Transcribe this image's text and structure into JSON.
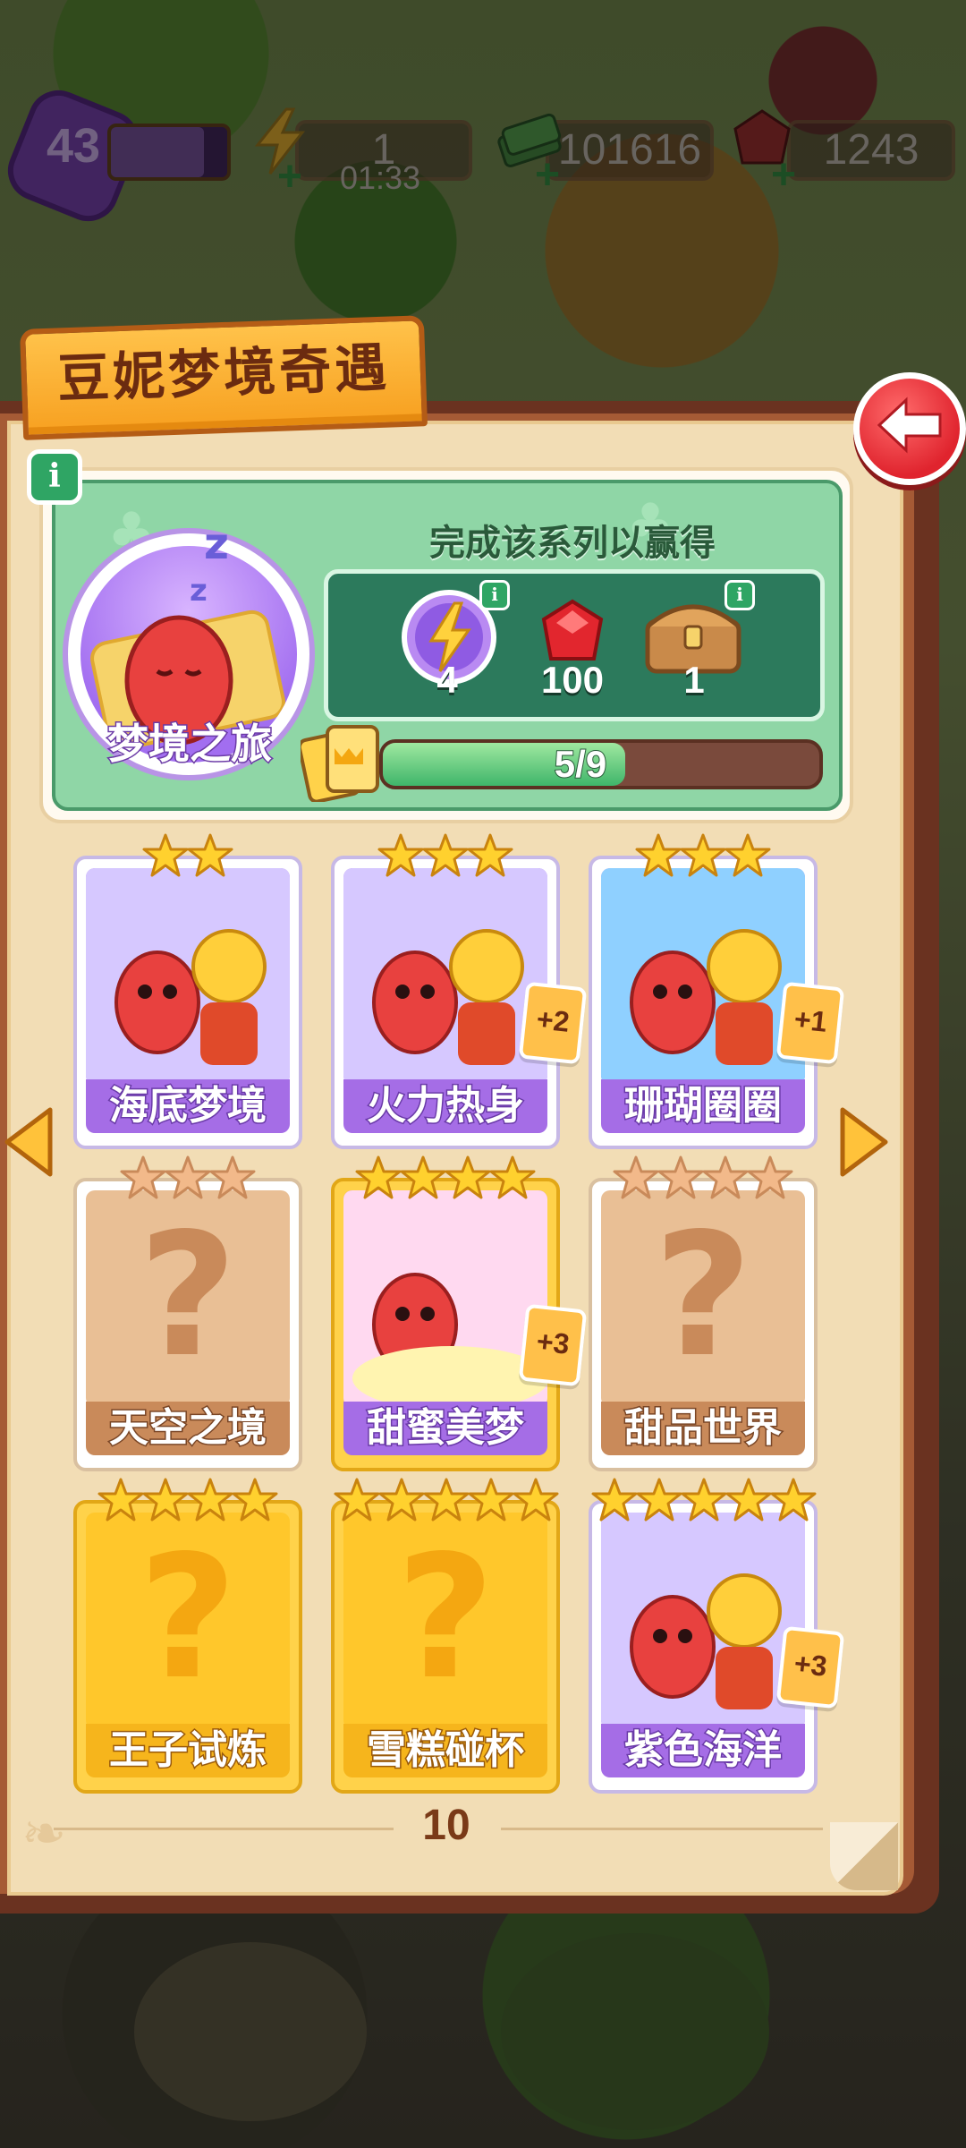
{
  "hud": {
    "level": "43",
    "energy": "1",
    "energy_timer": "01:33",
    "cash": "101616",
    "gems": "1243"
  },
  "book": {
    "title": "豆妮梦境奇遇",
    "info_label": "i",
    "page_number": "10"
  },
  "series": {
    "name": "梦境之旅",
    "reward_heading": "完成该系列以赢得",
    "rewards": [
      {
        "icon": "energy-orb-icon",
        "count": "4"
      },
      {
        "icon": "ruby-icon",
        "count": "100"
      },
      {
        "icon": "treasure-chest-icon",
        "count": "1"
      }
    ],
    "progress_text": "5/9",
    "progress": 0.5556
  },
  "cards": [
    {
      "name": "海底梦境",
      "stars": 2,
      "state": "unlocked",
      "dup": ""
    },
    {
      "name": "火力热身",
      "stars": 3,
      "state": "unlocked",
      "dup": "+2"
    },
    {
      "name": "珊瑚圈圈",
      "stars": 3,
      "state": "unlocked",
      "dup": "+1"
    },
    {
      "name": "天空之境",
      "stars": 3,
      "state": "locked-brown",
      "dup": ""
    },
    {
      "name": "甜蜜美梦",
      "stars": 4,
      "state": "gold-frame",
      "dup": "+3"
    },
    {
      "name": "甜品世界",
      "stars": 4,
      "state": "locked-brown",
      "dup": ""
    },
    {
      "name": "王子试炼",
      "stars": 4,
      "state": "locked-gold",
      "dup": ""
    },
    {
      "name": "雪糕碰杯",
      "stars": 5,
      "state": "locked-gold",
      "dup": ""
    },
    {
      "name": "紫色海洋",
      "stars": 5,
      "state": "unlocked",
      "dup": "+3"
    }
  ],
  "colors": {
    "accent_red": "#e0242e",
    "progress_green": "#3fb56a",
    "card_purple": "#a56de6",
    "locked_gold": "#f6b51c"
  }
}
